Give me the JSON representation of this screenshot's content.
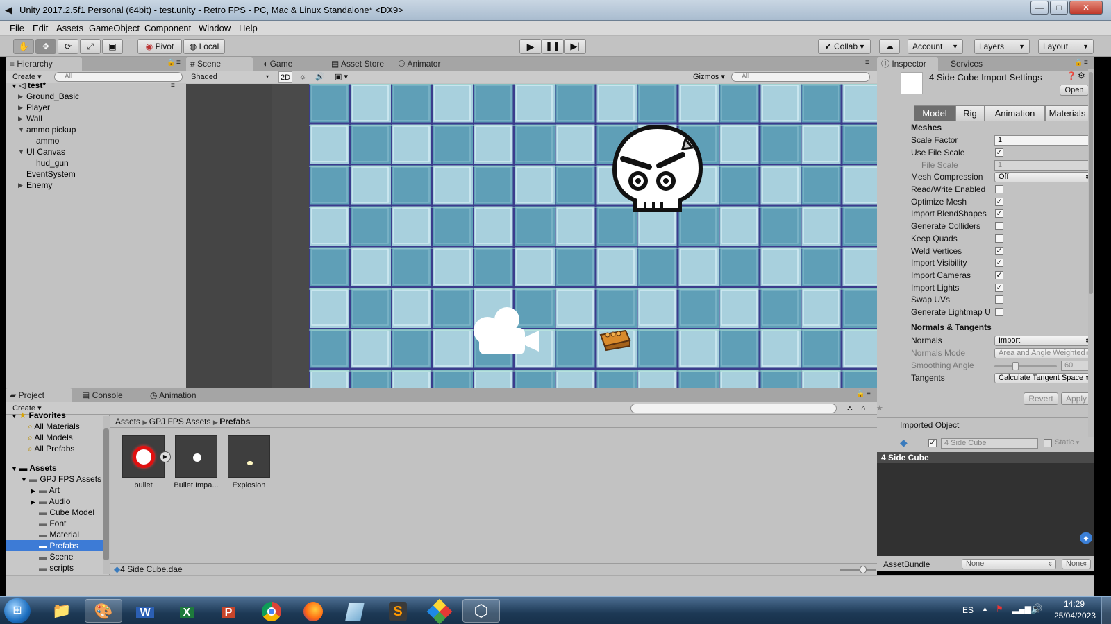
{
  "window": {
    "title": "Unity 2017.2.5f1 Personal (64bit) - test.unity - Retro FPS - PC, Mac & Linux Standalone* <DX9>",
    "minimize": "—",
    "maximize": "□",
    "close": "✕"
  },
  "menu": [
    "File",
    "Edit",
    "Assets",
    "GameObject",
    "Component",
    "Window",
    "Help"
  ],
  "toolbar": {
    "pivot": "Pivot",
    "local": "Local",
    "collab": "Collab",
    "account": "Account",
    "layers": "Layers",
    "layout": "Layout"
  },
  "hierarchy": {
    "tab": "Hierarchy",
    "create": "Create",
    "search_placeholder": "All",
    "scene": "test*",
    "items": [
      {
        "label": "Ground_Basic",
        "expanded": false
      },
      {
        "label": "Player",
        "expanded": false
      },
      {
        "label": "Wall",
        "expanded": false
      },
      {
        "label": "ammo pickup",
        "expanded": true
      },
      {
        "label": "ammo",
        "expanded": null
      },
      {
        "label": "UI Canvas",
        "expanded": true
      },
      {
        "label": "hud_gun",
        "expanded": null
      },
      {
        "label": "EventSystem",
        "expanded": null
      },
      {
        "label": "Enemy",
        "expanded": false
      }
    ]
  },
  "scene_view": {
    "tabs": [
      "Scene",
      "Game",
      "Asset Store",
      "Animator"
    ],
    "shading": "Shaded",
    "mode_2d": "2D",
    "gizmos": "Gizmos",
    "search_placeholder": "All"
  },
  "inspector": {
    "tabs": [
      "Inspector",
      "Services"
    ],
    "title": "4 Side Cube Import Settings",
    "open_button": "Open",
    "segments": [
      "Model",
      "Rig",
      "Animation",
      "Materials"
    ],
    "active_segment": "Model",
    "meshes_header": "Meshes",
    "scale_factor_label": "Scale Factor",
    "scale_factor_value": "1",
    "use_file_scale_label": "Use File Scale",
    "use_file_scale": true,
    "file_scale_label": "File Scale",
    "file_scale_value": "1",
    "mesh_compression_label": "Mesh Compression",
    "mesh_compression_value": "Off",
    "checks": [
      {
        "label": "Read/Write Enabled",
        "checked": false
      },
      {
        "label": "Optimize Mesh",
        "checked": true
      },
      {
        "label": "Import BlendShapes",
        "checked": true
      },
      {
        "label": "Generate Colliders",
        "checked": false
      },
      {
        "label": "Keep Quads",
        "checked": false
      },
      {
        "label": "Weld Vertices",
        "checked": true
      },
      {
        "label": "Import Visibility",
        "checked": true
      },
      {
        "label": "Import Cameras",
        "checked": true
      },
      {
        "label": "Import Lights",
        "checked": true
      },
      {
        "label": "Swap UVs",
        "checked": false
      },
      {
        "label": "Generate Lightmap U",
        "checked": false
      }
    ],
    "normals_header": "Normals & Tangents",
    "normals_label": "Normals",
    "normals_value": "Import",
    "normals_mode_label": "Normals Mode",
    "normals_mode_value": "Area and Angle Weighted",
    "smoothing_label": "Smoothing Angle",
    "smoothing_value": "60",
    "smoothing_fraction": 0.33,
    "tangents_label": "Tangents",
    "tangents_value": "Calculate Tangent Space",
    "revert": "Revert",
    "apply": "Apply",
    "imported_object": "Imported Object",
    "object_name": "4 Side Cube",
    "static_label": "Static",
    "preview_title": "4 Side Cube",
    "assetbundle_label": "AssetBundle",
    "assetbundle_value": "None",
    "assetbundle_variant": "None"
  },
  "project": {
    "tabs": [
      "Project",
      "Console",
      "Animation"
    ],
    "create": "Create",
    "favorites_header": "Favorites",
    "favorites": [
      "All Materials",
      "All Models",
      "All Prefabs"
    ],
    "assets_header": "Assets",
    "folders": [
      "GPJ FPS Assets",
      "Art",
      "Audio",
      "Cube Model",
      "Font",
      "Material",
      "Prefabs",
      "Scene",
      "scripts"
    ],
    "selected_folder": "Prefabs",
    "breadcrumb": [
      "Assets",
      "GPJ FPS Assets",
      "Prefabs"
    ],
    "assets": [
      "bullet",
      "Bullet Impa...",
      "Explosion"
    ],
    "status_file": "4 Side Cube.dae"
  },
  "taskbar": {
    "language": "ES",
    "time": "14:29",
    "date": "25/04/2023"
  },
  "colors": {
    "tile_dark": "#5f9fb7",
    "tile_light": "#a8d0dd",
    "grid_line": "#3b3c8c",
    "selection": "#3d7bd6"
  }
}
